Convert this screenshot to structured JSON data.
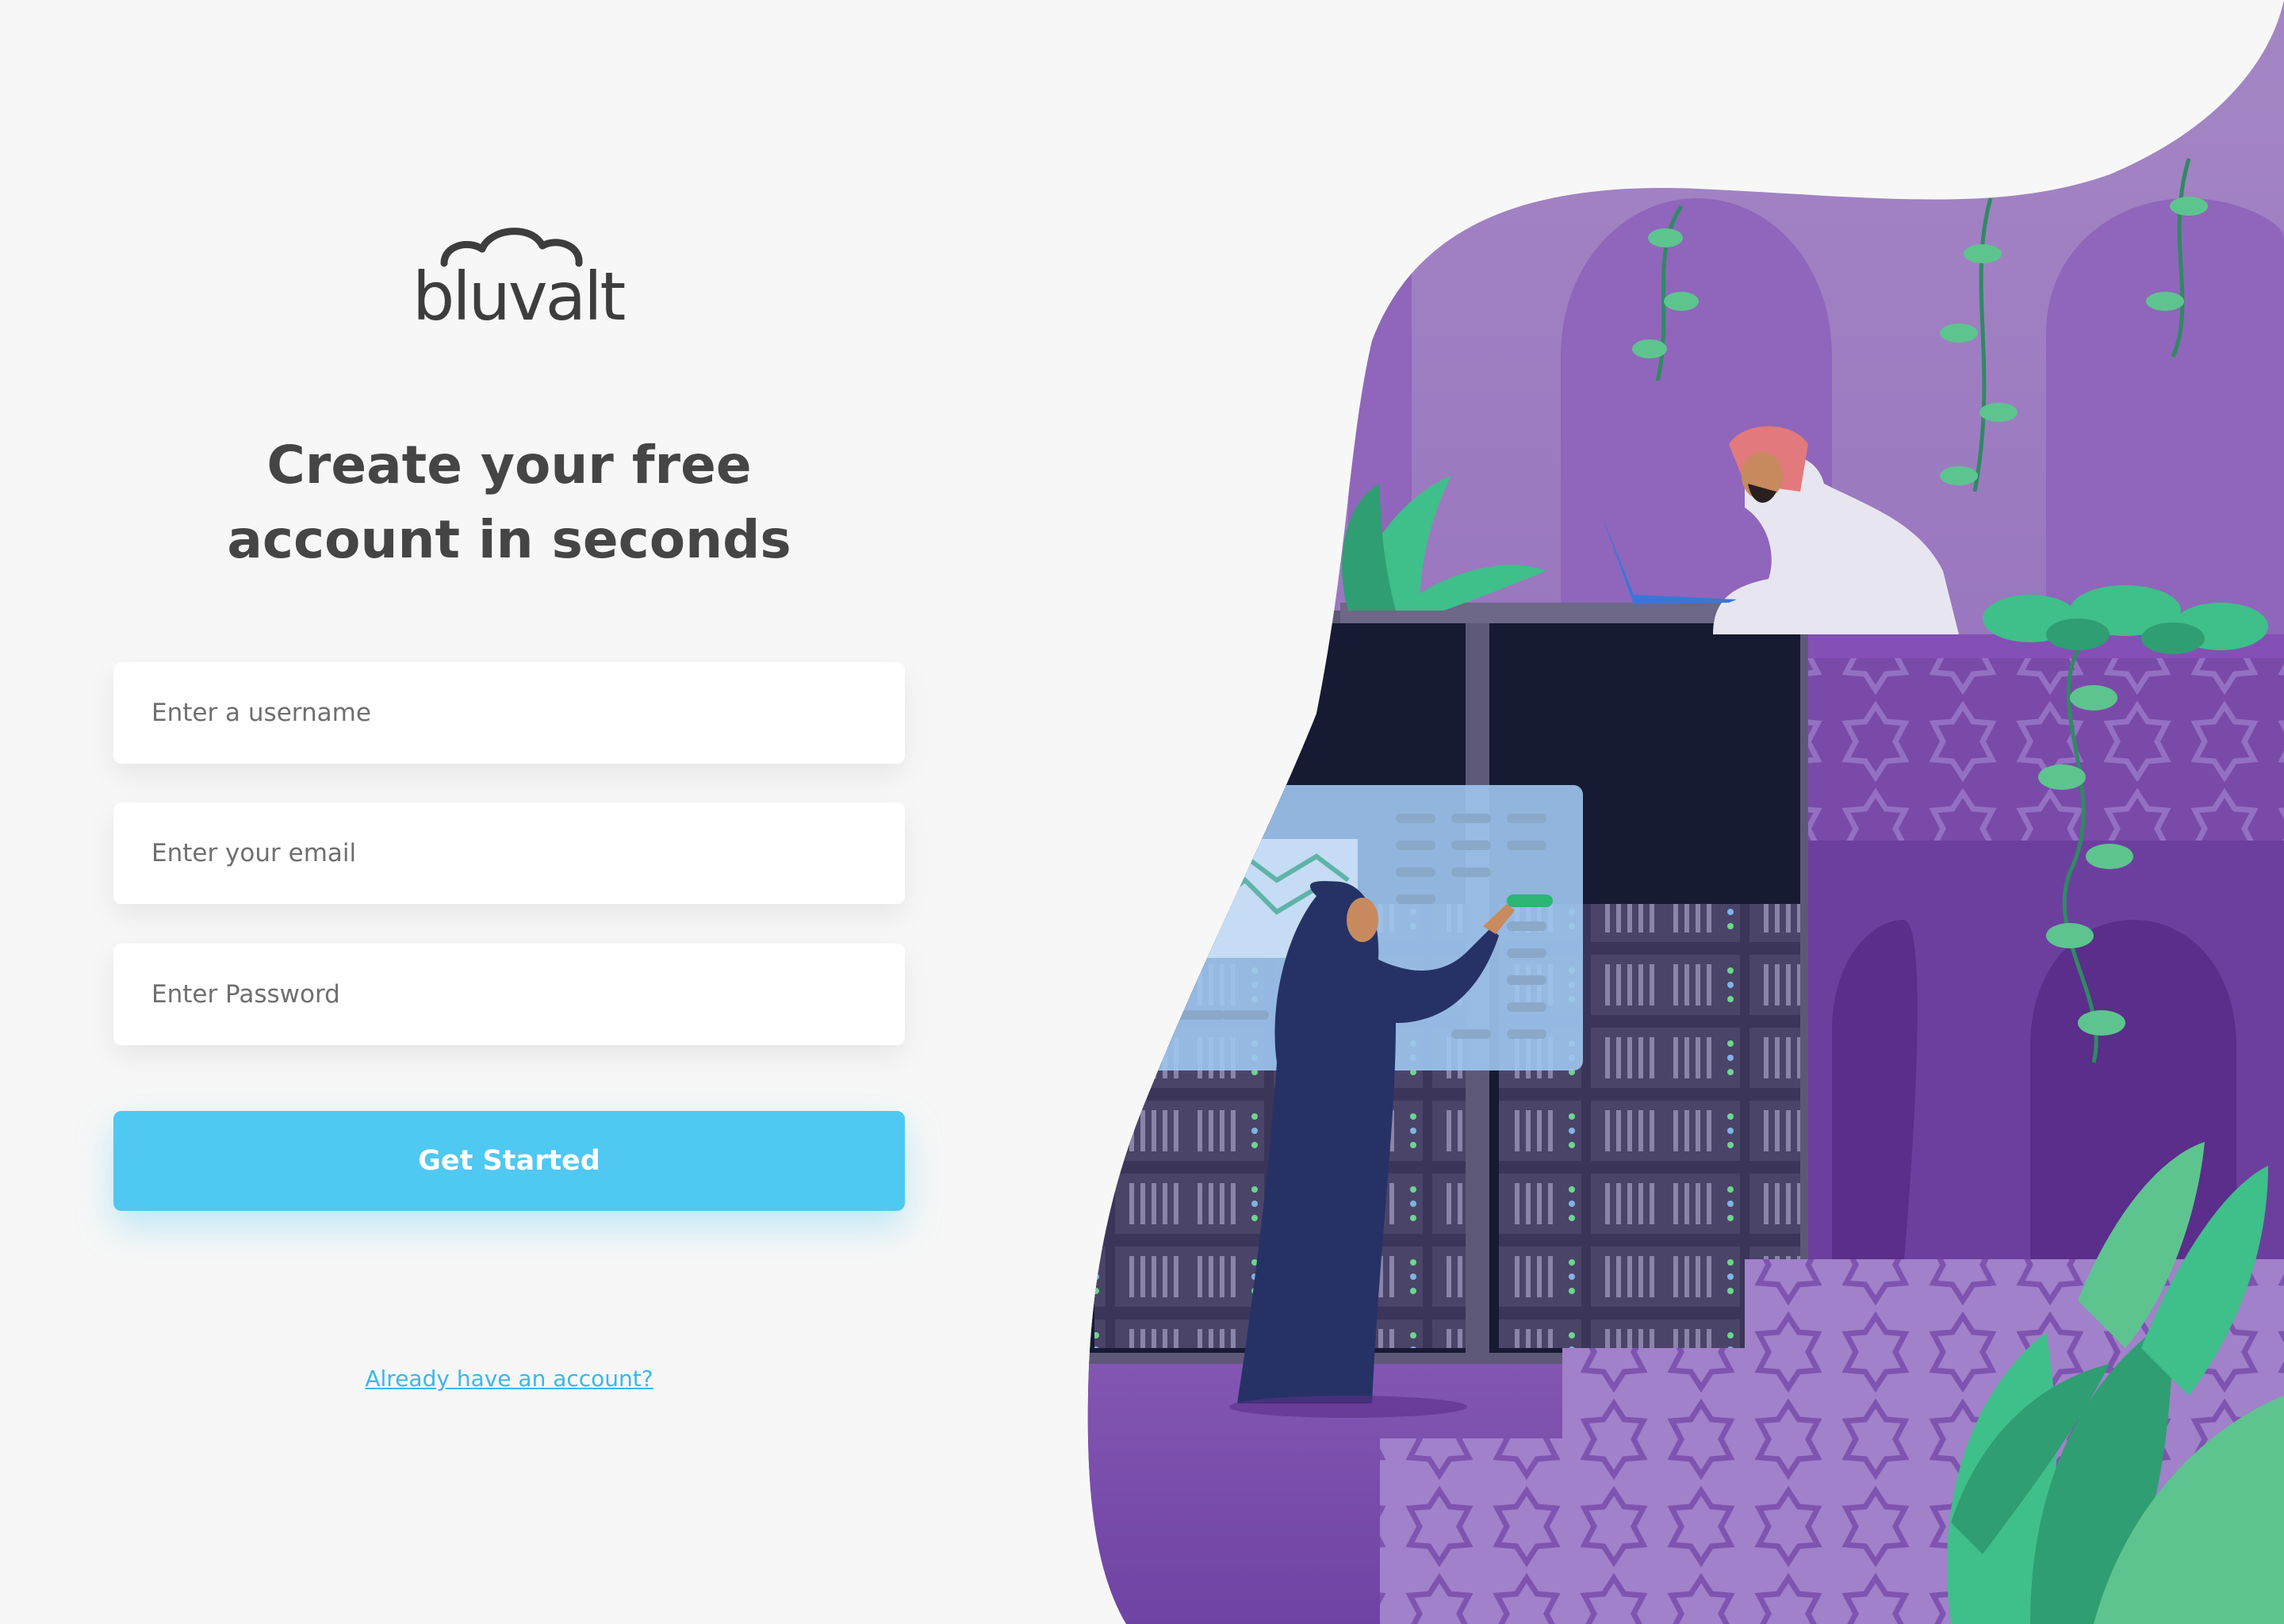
{
  "brand": {
    "name": "bluvalt"
  },
  "headline": {
    "line1": "Create your free",
    "line2": "account in seconds"
  },
  "form": {
    "username_placeholder": "Enter a username",
    "email_placeholder": "Enter your email",
    "password_placeholder": "Enter Password",
    "submit_label": "Get Started"
  },
  "footer": {
    "signin_link": "Already have an account?"
  },
  "colors": {
    "accent": "#4fc8f2",
    "link": "#3bb8e8",
    "text": "#454545",
    "background": "#f7f7f7",
    "illustration_purple": "#7b4fa8",
    "illustration_green": "#3fbf8a"
  }
}
